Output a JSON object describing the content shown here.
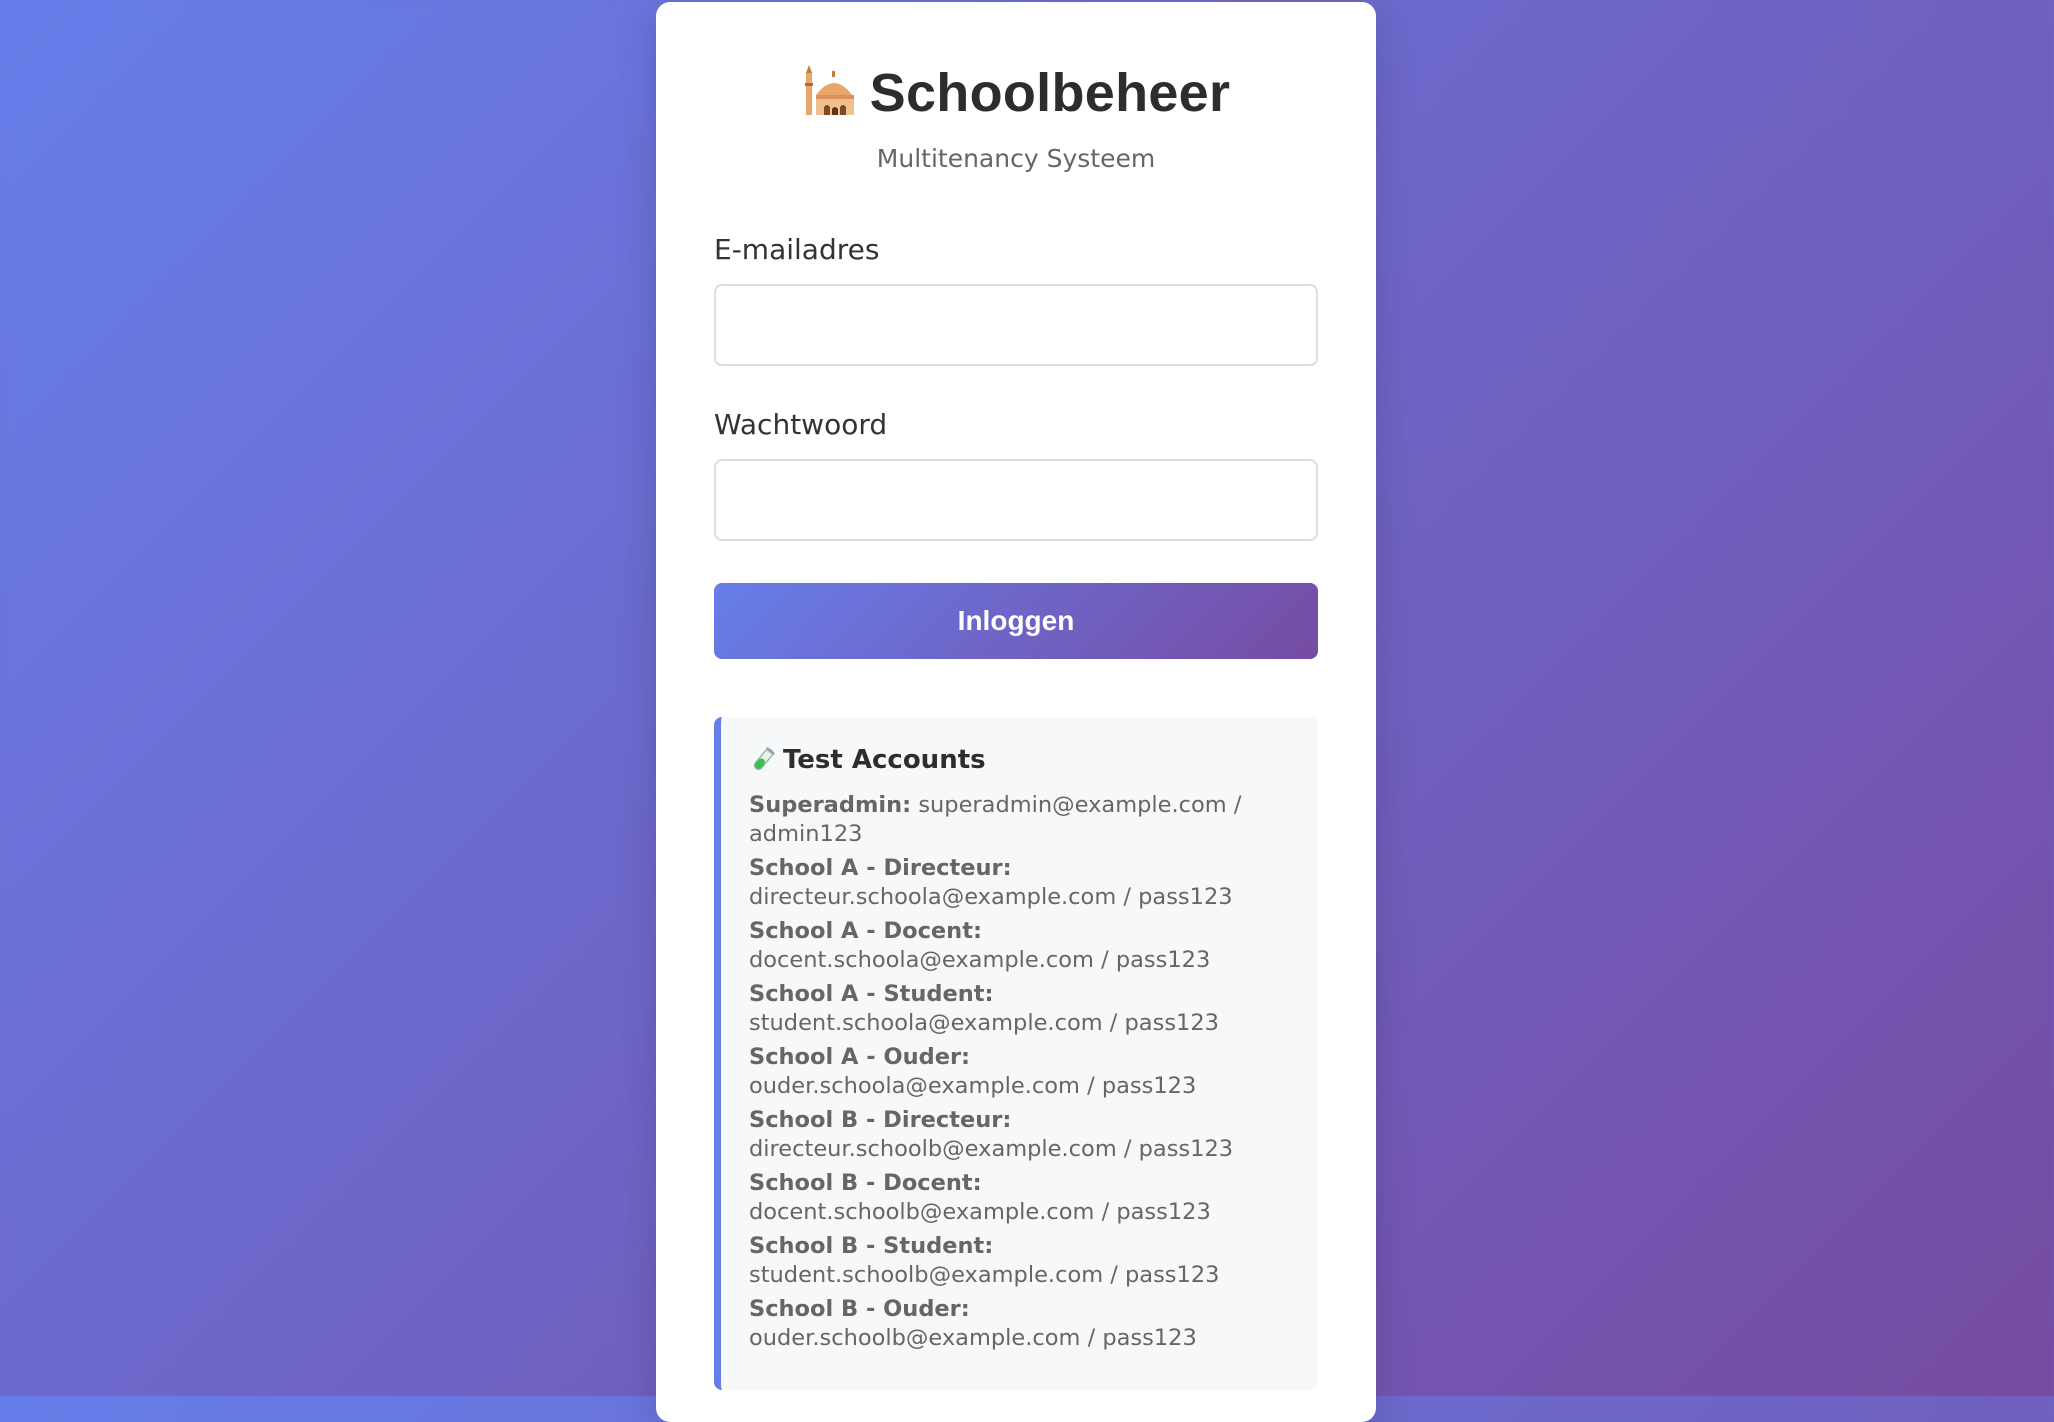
{
  "header": {
    "logo_icon": "mosque-icon",
    "title": "Schoolbeheer",
    "subtitle": "Multitenancy Systeem"
  },
  "form": {
    "email": {
      "label": "E-mailadres",
      "value": "",
      "placeholder": ""
    },
    "password": {
      "label": "Wachtwoord",
      "value": "",
      "placeholder": ""
    },
    "submit_label": "Inloggen"
  },
  "test_accounts": {
    "icon": "test-tube-icon",
    "title": "Test Accounts",
    "items": [
      {
        "role": "Superadmin:",
        "credentials": "superadmin@example.com / admin123"
      },
      {
        "role": "School A - Directeur:",
        "credentials": "directeur.schoola@example.com / pass123"
      },
      {
        "role": "School A - Docent:",
        "credentials": "docent.schoola@example.com / pass123"
      },
      {
        "role": "School A - Student:",
        "credentials": "student.schoola@example.com / pass123"
      },
      {
        "role": "School A - Ouder:",
        "credentials": "ouder.schoola@example.com / pass123"
      },
      {
        "role": "School B - Directeur:",
        "credentials": "directeur.schoolb@example.com / pass123"
      },
      {
        "role": "School B - Docent:",
        "credentials": "docent.schoolb@example.com / pass123"
      },
      {
        "role": "School B - Student:",
        "credentials": "student.schoolb@example.com / pass123"
      },
      {
        "role": "School B - Ouder:",
        "credentials": "ouder.schoolb@example.com / pass123"
      }
    ]
  },
  "colors": {
    "gradient_start": "#667eea",
    "gradient_end": "#764ba2",
    "card_background": "#ffffff",
    "text_primary": "#2d2d2d",
    "text_secondary": "#666666"
  }
}
